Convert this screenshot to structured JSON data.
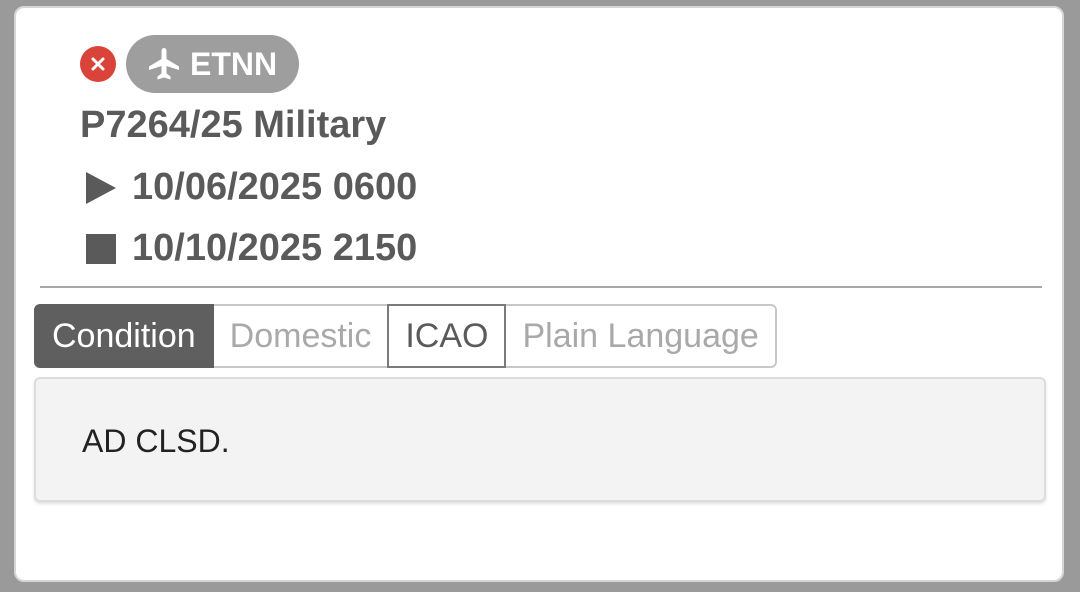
{
  "notam": {
    "airport_code": "ETNN",
    "title": "P7264/25 Military",
    "start": "10/06/2025 0600",
    "end": "10/10/2025 2150"
  },
  "icons": {
    "close": "close-icon",
    "airport": "airplane-icon",
    "start": "play-icon",
    "end": "stop-icon"
  },
  "tabs": [
    {
      "label": "Condition",
      "active": true
    },
    {
      "label": "Domestic",
      "active": false
    },
    {
      "label": "ICAO",
      "active": false
    },
    {
      "label": "Plain Language",
      "active": false
    }
  ],
  "content": {
    "text": "AD CLSD."
  },
  "colors": {
    "close": "#d9433a",
    "badge": "#9e9e9e",
    "active_tab": "#5f5f5f",
    "panel": "#f3f3f3"
  }
}
